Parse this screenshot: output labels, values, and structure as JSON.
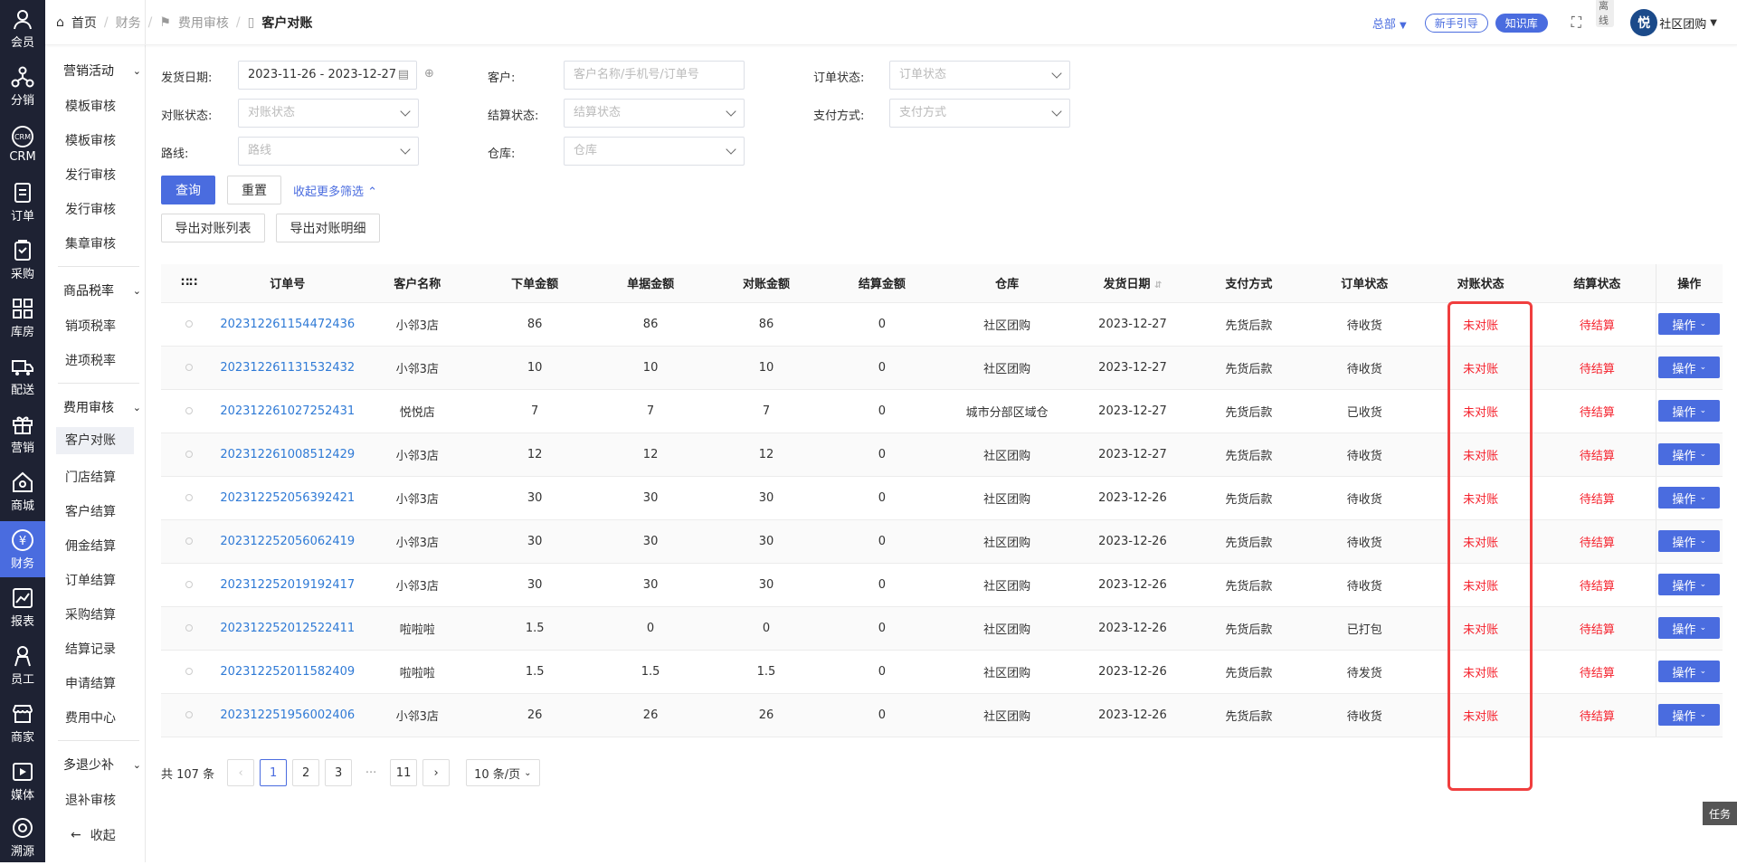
{
  "rail": [
    {
      "label": "会员",
      "icon": "member-icon"
    },
    {
      "label": "分销",
      "icon": "distribution-icon"
    },
    {
      "label": "CRM",
      "icon": "crm-icon"
    },
    {
      "label": "订单",
      "icon": "order-icon"
    },
    {
      "label": "采购",
      "icon": "purchase-icon"
    },
    {
      "label": "库房",
      "icon": "warehouse-icon"
    },
    {
      "label": "配送",
      "icon": "delivery-icon"
    },
    {
      "label": "营销",
      "icon": "gift-icon"
    },
    {
      "label": "商城",
      "icon": "shop-icon"
    },
    {
      "label": "财务",
      "icon": "yen-icon"
    },
    {
      "label": "报表",
      "icon": "report-icon"
    },
    {
      "label": "员工",
      "icon": "staff-icon"
    },
    {
      "label": "商家",
      "icon": "merchant-icon"
    },
    {
      "label": "媒体",
      "icon": "media-icon"
    },
    {
      "label": "溯源",
      "icon": "trace-icon"
    }
  ],
  "submenu": {
    "g1": "营销活动",
    "i1": "模板审核",
    "i2": "模板审核",
    "i3": "发行审核",
    "i4": "发行审核",
    "i5": "集章审核",
    "g2": "商品税率",
    "i6": "销项税率",
    "i7": "进项税率",
    "g3": "费用审核",
    "i8": "客户对账",
    "i9": "门店结算",
    "i10": "客户结算",
    "i11": "佣金结算",
    "i12": "订单结算",
    "i13": "采购结算",
    "i14": "结算记录",
    "i15": "申请结算",
    "i16": "费用中心",
    "g4": "多退少补",
    "i17": "退补审核",
    "collapse": "收起"
  },
  "breadcrumb": {
    "home": "首页",
    "b1": "财务",
    "b2": "费用审核",
    "current": "客户对账"
  },
  "topbar": {
    "org": "总部",
    "guide": "新手引导",
    "knowledge": "知识库",
    "offline": "离线",
    "store": "社区团购",
    "logo_char": "悦"
  },
  "filters": {
    "ship_date_label": "发货日期:",
    "ship_date_value": "2023-11-26 - 2023-12-27",
    "customer_label": "客户:",
    "customer_ph": "客户名称/手机号/订单号",
    "order_status_label": "订单状态:",
    "order_status_ph": "订单状态",
    "recon_status_label": "对账状态:",
    "recon_status_ph": "对账状态",
    "settle_status_label": "结算状态:",
    "settle_status_ph": "结算状态",
    "pay_label": "支付方式:",
    "pay_ph": "支付方式",
    "route_label": "路线:",
    "route_ph": "路线",
    "wh_label": "仓库:",
    "wh_ph": "仓库",
    "query": "查询",
    "reset": "重置",
    "collapse_more": "收起更多筛选",
    "export_list": "导出对账列表",
    "export_detail": "导出对账明细"
  },
  "table": {
    "headers": [
      "订单号",
      "客户名称",
      "下单金额",
      "单据金额",
      "对账金额",
      "结算金额",
      "仓库",
      "发货日期",
      "支付方式",
      "订单状态",
      "对账状态",
      "结算状态",
      "操作"
    ],
    "rows": [
      [
        "202312261154472436",
        "小邻3店",
        "86",
        "86",
        "86",
        "0",
        "社区团购",
        "2023-12-27",
        "先货后款",
        "待收货",
        "未对账",
        "待结算",
        "操作"
      ],
      [
        "202312261131532432",
        "小邻3店",
        "10",
        "10",
        "10",
        "0",
        "社区团购",
        "2023-12-27",
        "先货后款",
        "待收货",
        "未对账",
        "待结算",
        "操作"
      ],
      [
        "202312261027252431",
        "悦悦店",
        "7",
        "7",
        "7",
        "0",
        "城市分部区域仓",
        "2023-12-27",
        "先货后款",
        "已收货",
        "未对账",
        "待结算",
        "操作"
      ],
      [
        "202312261008512429",
        "小邻3店",
        "12",
        "12",
        "12",
        "0",
        "社区团购",
        "2023-12-27",
        "先货后款",
        "待收货",
        "未对账",
        "待结算",
        "操作"
      ],
      [
        "202312252056392421",
        "小邻3店",
        "30",
        "30",
        "30",
        "0",
        "社区团购",
        "2023-12-26",
        "先货后款",
        "待收货",
        "未对账",
        "待结算",
        "操作"
      ],
      [
        "202312252056062419",
        "小邻3店",
        "30",
        "30",
        "30",
        "0",
        "社区团购",
        "2023-12-26",
        "先货后款",
        "待收货",
        "未对账",
        "待结算",
        "操作"
      ],
      [
        "202312252019192417",
        "小邻3店",
        "30",
        "30",
        "30",
        "0",
        "社区团购",
        "2023-12-26",
        "先货后款",
        "待收货",
        "未对账",
        "待结算",
        "操作"
      ],
      [
        "202312252012522411",
        "啦啦啦",
        "1.5",
        "0",
        "0",
        "0",
        "社区团购",
        "2023-12-26",
        "先货后款",
        "已打包",
        "未对账",
        "待结算",
        "操作"
      ],
      [
        "202312252011582409",
        "啦啦啦",
        "1.5",
        "1.5",
        "1.5",
        "0",
        "社区团购",
        "2023-12-26",
        "先货后款",
        "待发货",
        "未对账",
        "待结算",
        "操作"
      ],
      [
        "202312251956002406",
        "小邻3店",
        "26",
        "26",
        "26",
        "0",
        "社区团购",
        "2023-12-26",
        "先货后款",
        "待收货",
        "未对账",
        "待结算",
        "操作"
      ]
    ]
  },
  "pager": {
    "total": "共 107 条",
    "p1": "1",
    "p2": "2",
    "p3": "3",
    "dots": "···",
    "p11": "11",
    "size": "10 条/页"
  },
  "task": "任务",
  "colors": {
    "accent": "#4a6cdf",
    "rail": "#1e2233",
    "red": "#f5222d",
    "highlight": "#f03e3e"
  }
}
